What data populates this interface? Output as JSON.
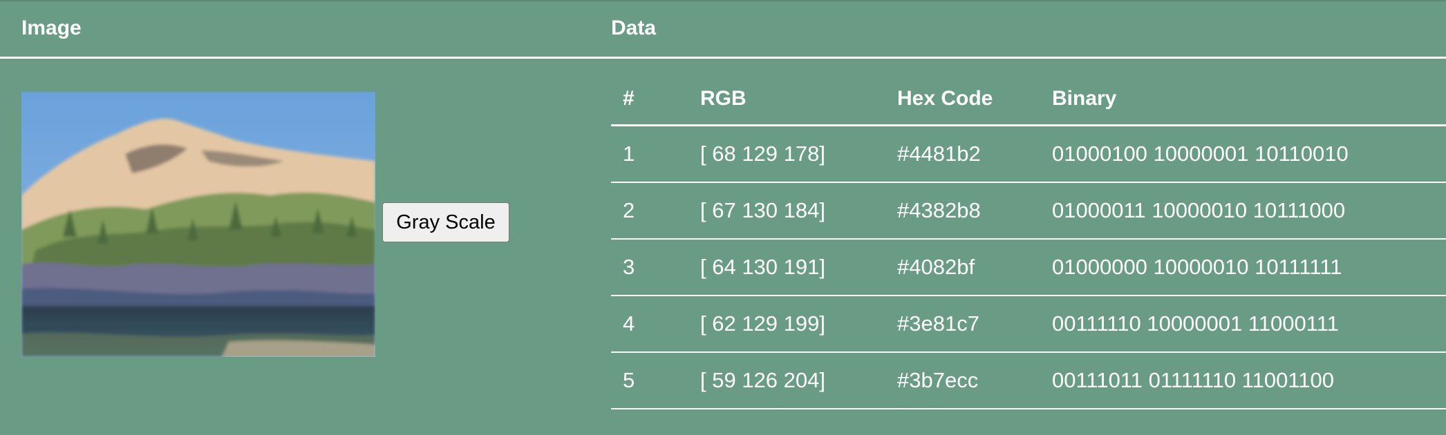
{
  "header": {
    "image_label": "Image",
    "data_label": "Data"
  },
  "image_panel": {
    "image_description": "landscape painting of a sandy mountain with green trees and a lake",
    "gray_scale_button": "Gray Scale"
  },
  "table": {
    "columns": [
      "#",
      "RGB",
      "Hex Code",
      "Binary"
    ],
    "rows": [
      {
        "num": "1",
        "rgb": "[ 68 129 178]",
        "hex": "#4481b2",
        "binary": "01000100 10000001 10110010"
      },
      {
        "num": "2",
        "rgb": "[ 67 130 184]",
        "hex": "#4382b8",
        "binary": "01000011 10000010 10111000"
      },
      {
        "num": "3",
        "rgb": "[ 64 130 191]",
        "hex": "#4082bf",
        "binary": "01000000 10000010 10111111"
      },
      {
        "num": "4",
        "rgb": "[ 62 129 199]",
        "hex": "#3e81c7",
        "binary": "00111110 10000001 11000111"
      },
      {
        "num": "5",
        "rgb": "[ 59 126 204]",
        "hex": "#3b7ecc",
        "binary": "00111011 01111110 11001100"
      }
    ]
  },
  "colors": {
    "background": "#6a9c85",
    "text": "#ffffff",
    "button_bg": "#efefef"
  }
}
